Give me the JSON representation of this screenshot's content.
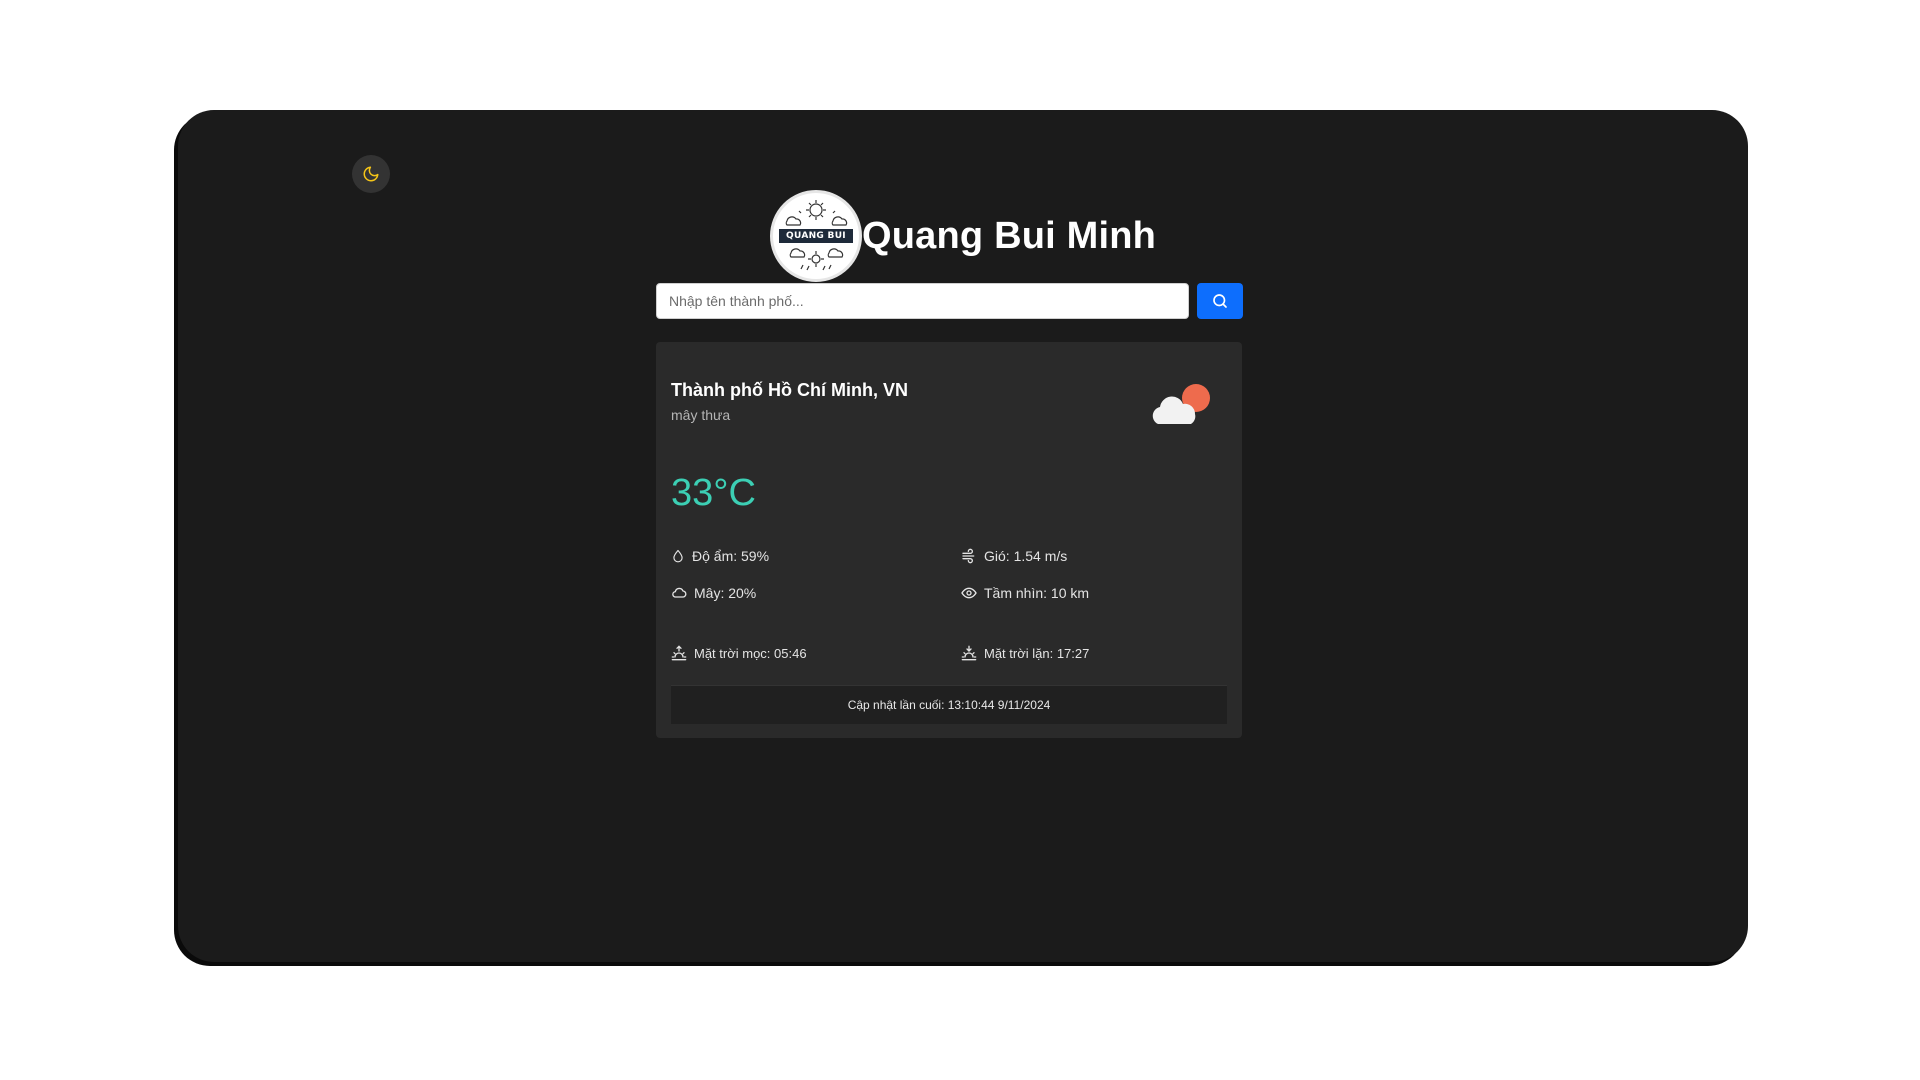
{
  "header": {
    "title": "Quang Bui Minh",
    "logo_text": "QUANG BUI"
  },
  "theme_toggle": {
    "icon": "moon-icon",
    "color": "#f5c518"
  },
  "search": {
    "placeholder": "Nhập tên thành phố...",
    "value": "",
    "button_icon": "search-icon",
    "button_color": "#0d6efd"
  },
  "weather": {
    "city": "Thành phố Hồ Chí Minh, VN",
    "description": "mây thưa",
    "icon": "partly-cloudy-icon",
    "temperature": "33°C",
    "temperature_color": "#3ccfb4",
    "humidity": "Độ ẩm: 59%",
    "wind": "Gió: 1.54 m/s",
    "clouds": "Mây: 20%",
    "visibility": "Tầm nhìn: 10 km",
    "sunrise": "Mặt trời mọc: 05:46",
    "sunset": "Mặt trời lặn: 17:27",
    "last_updated": "Cập nhật lần cuối: 13:10:44 9/11/2024"
  }
}
